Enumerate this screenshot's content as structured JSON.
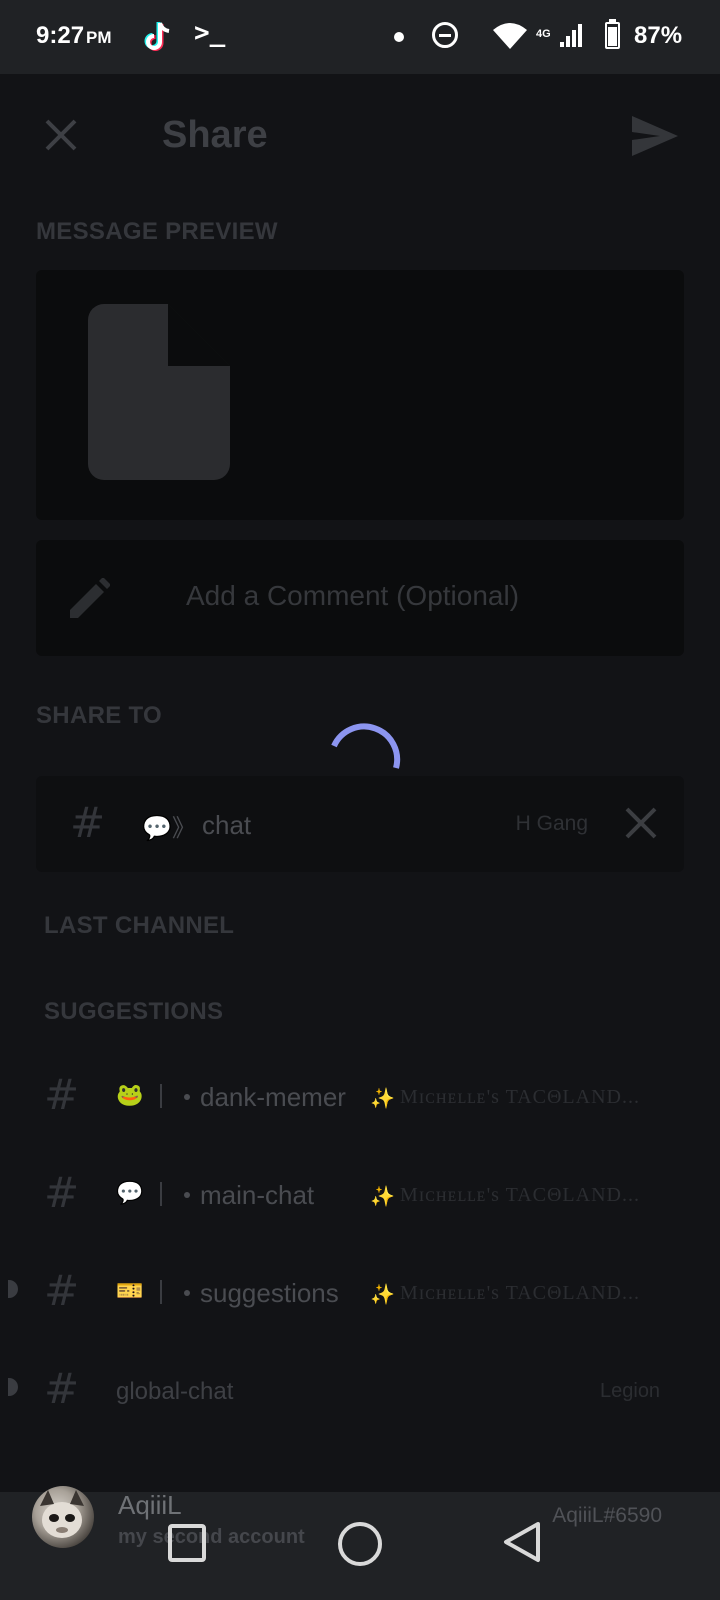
{
  "status_bar": {
    "time": "9:27",
    "ampm": "PM",
    "terminal_glyph": ">_",
    "network": "4G",
    "battery": "87%",
    "icons": [
      "tiktok-icon",
      "terminal-icon",
      "notification-dot-icon",
      "do-not-disturb-icon",
      "wifi-icon",
      "signal-icon",
      "battery-icon"
    ]
  },
  "header": {
    "title": "Share",
    "close_icon": "close-icon",
    "send_icon": "send-icon"
  },
  "message_preview": {
    "label": "MESSAGE PREVIEW",
    "file_icon": "file-icon"
  },
  "comment": {
    "placeholder": "Add a Comment (Optional)",
    "icon": "pencil-icon"
  },
  "share_to": {
    "label": "SHARE TO",
    "channel": {
      "prefix": "💬》",
      "name": "chat",
      "server": "H Gang"
    }
  },
  "last_channel": {
    "label": "LAST CHANNEL"
  },
  "suggestions": {
    "label": "SUGGESTIONS",
    "items": [
      {
        "emoji": "🐸",
        "name": "dank-memer",
        "server": "Mɪᴄʜᴇʟʟᴇ's TACΘLAND...",
        "server_emoji": "✨"
      },
      {
        "emoji": "💬",
        "name": "main-chat",
        "server": "Mɪᴄʜᴇʟʟᴇ's TACΘLAND...",
        "server_emoji": "✨"
      },
      {
        "emoji": "🎫",
        "name": "suggestions",
        "server": "Mɪᴄʜᴇʟʟᴇ's TACΘLAND...",
        "server_emoji": "✨"
      },
      {
        "emoji": "",
        "name": "global-chat",
        "server": "Legion",
        "server_emoji": ""
      }
    ]
  },
  "account": {
    "name": "AqiiiL",
    "subtitle": "my second account",
    "tag": "AqiiiL#6590"
  },
  "colors": {
    "spinner": "#8c95f0",
    "background": "#121316",
    "status_bar": "#202225"
  }
}
